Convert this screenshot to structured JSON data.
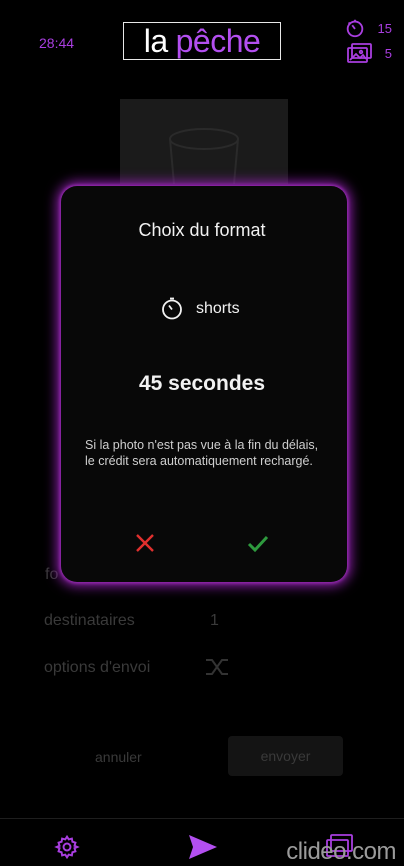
{
  "header": {
    "timer": "28:44",
    "logo": {
      "word1": "la",
      "word2": "pêche"
    },
    "stats": {
      "timers_count": "15",
      "photos_count": "5"
    }
  },
  "background": {
    "row_partial_left": "fo",
    "recipients_label": "destinataires",
    "recipients_value": "1",
    "options_label": "options d'envoi",
    "cancel_label": "annuler",
    "send_label": "envoyer"
  },
  "modal": {
    "title": "Choix du format",
    "format_label": "shorts",
    "duration": "45 secondes",
    "note": "Si la photo n'est pas vue à la fin du délais, le crédit sera automatiquement rechargé."
  },
  "watermark": "clideo.com",
  "colors": {
    "accent": "#a93ee0",
    "cancel": "#e0302e",
    "confirm": "#2e9a3e"
  }
}
